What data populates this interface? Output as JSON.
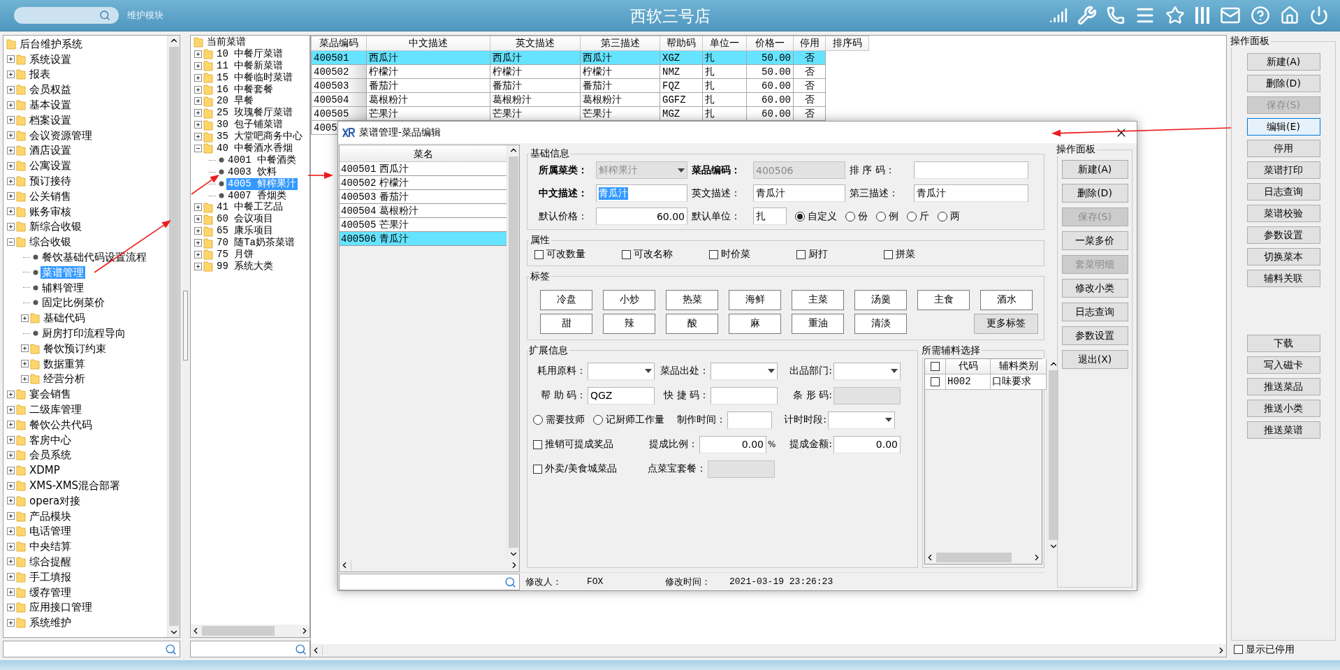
{
  "top_bar": {
    "module_label": "维护模块",
    "title": "西软三号店"
  },
  "system_tree": {
    "items": [
      {
        "label": "后台维护系统",
        "kind": "folder",
        "selected": false,
        "children": [
          {
            "label": "系统设置",
            "kind": "folder",
            "expanded": false,
            "selected": false
          },
          {
            "label": "报表",
            "kind": "folder",
            "expanded": false,
            "selected": false
          },
          {
            "label": "会员权益",
            "kind": "folder",
            "expanded": false,
            "selected": false
          },
          {
            "label": "基本设置",
            "kind": "folder",
            "expanded": false,
            "selected": false
          },
          {
            "label": "档案设置",
            "kind": "folder",
            "expanded": false,
            "selected": false
          },
          {
            "label": "会议资源管理",
            "kind": "folder",
            "expanded": false,
            "selected": false
          },
          {
            "label": "酒店设置",
            "kind": "folder",
            "expanded": false,
            "selected": false
          },
          {
            "label": "公寓设置",
            "kind": "folder",
            "expanded": false,
            "selected": false
          },
          {
            "label": "预订接待",
            "kind": "folder",
            "expanded": false,
            "selected": false
          },
          {
            "label": "公关销售",
            "kind": "folder",
            "expanded": false,
            "selected": false
          },
          {
            "label": "账务审核",
            "kind": "folder",
            "expanded": false,
            "selected": false
          },
          {
            "label": "新综合收银",
            "kind": "folder",
            "expanded": false,
            "selected": false
          },
          {
            "label": "综合收银",
            "kind": "folder",
            "expanded": true,
            "selected": false,
            "children": [
              {
                "label": "餐饮基础代码设置流程",
                "kind": "leaf",
                "selected": false
              },
              {
                "label": "菜谱管理",
                "kind": "leaf",
                "selected": true
              },
              {
                "label": "辅料管理",
                "kind": "leaf",
                "selected": false
              },
              {
                "label": "固定比例菜价",
                "kind": "leaf",
                "selected": false
              },
              {
                "label": "基础代码",
                "kind": "folder",
                "expanded": false,
                "selected": false
              },
              {
                "label": "厨房打印流程导向",
                "kind": "leaf",
                "selected": false
              },
              {
                "label": "餐饮预订约束",
                "kind": "folder",
                "expanded": false,
                "selected": false
              },
              {
                "label": "数据重算",
                "kind": "folder",
                "expanded": false,
                "selected": false
              },
              {
                "label": "经营分析",
                "kind": "folder",
                "expanded": false,
                "selected": false
              }
            ]
          },
          {
            "label": "宴会销售",
            "kind": "folder",
            "expanded": false,
            "selected": false
          },
          {
            "label": "二级库管理",
            "kind": "folder",
            "expanded": false,
            "selected": false
          },
          {
            "label": "餐饮公共代码",
            "kind": "folder",
            "expanded": false,
            "selected": false
          },
          {
            "label": "客房中心",
            "kind": "folder",
            "expanded": false,
            "selected": false
          },
          {
            "label": "会员系统",
            "kind": "folder",
            "expanded": false,
            "selected": false
          },
          {
            "label": "XDMP",
            "kind": "folder",
            "expanded": false,
            "selected": false
          },
          {
            "label": "XMS-XMS混合部署",
            "kind": "folder",
            "expanded": false,
            "selected": false
          },
          {
            "label": "opera对接",
            "kind": "folder",
            "expanded": false,
            "selected": false
          },
          {
            "label": "产品模块",
            "kind": "folder",
            "expanded": false,
            "selected": false
          },
          {
            "label": "电话管理",
            "kind": "folder",
            "expanded": false,
            "selected": false
          },
          {
            "label": "中央结算",
            "kind": "folder",
            "expanded": false,
            "selected": false
          },
          {
            "label": "综合提醒",
            "kind": "folder",
            "expanded": false,
            "selected": false
          },
          {
            "label": "手工填报",
            "kind": "folder",
            "expanded": false,
            "selected": false
          },
          {
            "label": "缓存管理",
            "kind": "folder",
            "expanded": false,
            "selected": false
          },
          {
            "label": "应用接口管理",
            "kind": "folder",
            "expanded": false,
            "selected": false
          },
          {
            "label": "系统维护",
            "kind": "folder",
            "expanded": false,
            "selected": false
          }
        ]
      }
    ]
  },
  "menu_tree": {
    "items": [
      {
        "label": "当前菜谱",
        "kind": "folder",
        "selected": false,
        "children": [
          {
            "label": "10 中餐厅菜谱",
            "kind": "folder",
            "expanded": false,
            "selected": false
          },
          {
            "label": "11 中餐新菜谱",
            "kind": "folder",
            "expanded": false,
            "selected": false
          },
          {
            "label": "15 中餐临时菜谱",
            "kind": "folder",
            "expanded": false,
            "selected": false
          },
          {
            "label": "16 中餐套餐",
            "kind": "folder",
            "expanded": false,
            "selected": false
          },
          {
            "label": "20 早餐",
            "kind": "folder",
            "expanded": false,
            "selected": false
          },
          {
            "label": "25 玫瑰餐厅菜谱",
            "kind": "folder",
            "expanded": false,
            "selected": false
          },
          {
            "label": "30 包子铺菜谱",
            "kind": "folder",
            "expanded": false,
            "selected": false
          },
          {
            "label": "35 大堂吧商务中心",
            "kind": "folder",
            "expanded": false,
            "selected": false
          },
          {
            "label": "40 中餐酒水香烟",
            "kind": "folder",
            "expanded": true,
            "selected": false,
            "children": [
              {
                "label": "4001 中餐酒类",
                "kind": "leaf",
                "selected": false
              },
              {
                "label": "4003 饮料",
                "kind": "leaf",
                "selected": false
              },
              {
                "label": "4005 鲜榨果汁",
                "kind": "leaf",
                "selected": true
              },
              {
                "label": "4007 香烟类",
                "kind": "leaf",
                "selected": false
              }
            ]
          },
          {
            "label": "41 中餐工艺品",
            "kind": "folder",
            "expanded": false,
            "selected": false
          },
          {
            "label": "60 会议项目",
            "kind": "folder",
            "expanded": false,
            "selected": false
          },
          {
            "label": "65 康乐项目",
            "kind": "folder",
            "expanded": false,
            "selected": false
          },
          {
            "label": "70 随Ta奶茶菜谱",
            "kind": "folder",
            "expanded": false,
            "selected": false
          },
          {
            "label": "75 月饼",
            "kind": "folder",
            "expanded": false,
            "selected": false
          },
          {
            "label": "99 系统大类",
            "kind": "folder",
            "expanded": false,
            "selected": false
          }
        ]
      }
    ]
  },
  "dish_table": {
    "columns": [
      "菜品编码",
      "中文描述",
      "英文描述",
      "第三描述",
      "帮助码",
      "单位一",
      "价格一",
      "停用",
      "排序码"
    ],
    "rows": [
      {
        "selected": true,
        "cells": [
          "400501",
          "西瓜汁",
          "西瓜汁",
          "西瓜汁",
          "XGZ",
          "扎",
          "50.00",
          "否"
        ]
      },
      {
        "selected": false,
        "cells": [
          "400502",
          "柠檬汁",
          "柠檬汁",
          "柠檬汁",
          "NMZ",
          "扎",
          "50.00",
          "否"
        ]
      },
      {
        "selected": false,
        "cells": [
          "400503",
          "番茄汁",
          "番茄汁",
          "番茄汁",
          "FQZ",
          "扎",
          "60.00",
          "否"
        ]
      },
      {
        "selected": false,
        "cells": [
          "400504",
          "葛根粉汁",
          "葛根粉汁",
          "葛根粉汁",
          "GGFZ",
          "扎",
          "60.00",
          "否"
        ]
      },
      {
        "selected": false,
        "cells": [
          "400505",
          "芒果汁",
          "芒果汁",
          "芒果汁",
          "MGZ",
          "扎",
          "60.00",
          "否"
        ]
      },
      {
        "selected": false,
        "cells": [
          "4005"
        ]
      }
    ]
  },
  "edit_dialog": {
    "title": "菜谱管理-菜品编辑",
    "dish_list": {
      "header": "菜名",
      "items": [
        {
          "code": "400501",
          "name": "西瓜汁",
          "selected": false
        },
        {
          "code": "400502",
          "name": "柠檬汁",
          "selected": false
        },
        {
          "code": "400503",
          "name": "番茄汁",
          "selected": false
        },
        {
          "code": "400504",
          "name": "葛根粉汁",
          "selected": false
        },
        {
          "code": "400505",
          "name": "芒果汁",
          "selected": false
        },
        {
          "code": "400506",
          "name": "青瓜汁",
          "selected": true
        }
      ]
    },
    "basic_info": {
      "title": "基础信息",
      "rows": [
        [
          {
            "label": "所属菜类：",
            "kind": "select",
            "value": "鲜榨果汁",
            "disabled": true,
            "emphasized": true,
            "highlighted": false
          },
          {
            "label": "菜品编码：",
            "kind": "text",
            "value": "400506",
            "disabled": true,
            "emphasized": true,
            "highlighted": false
          },
          {
            "label": "排 序 码：",
            "kind": "text",
            "disabled": false,
            "emphasized": false
          }
        ],
        [
          {
            "label": "中文描述：",
            "kind": "text",
            "value": "青瓜汁",
            "disabled": false,
            "emphasized": true,
            "highlighted": true
          },
          {
            "label": "英文描述：",
            "kind": "text",
            "value": "青瓜汁",
            "disabled": false,
            "emphasized": false,
            "highlighted": false
          },
          {
            "label": "第三描述：",
            "kind": "text",
            "value": "青瓜汁",
            "disabled": false,
            "emphasized": false,
            "highlighted": false
          }
        ],
        [
          {
            "label": "默认价格：",
            "kind": "number",
            "value": "60.00",
            "disabled": false,
            "emphasized": false,
            "highlighted": false
          },
          {
            "label": "默认单位：",
            "kind": "unit",
            "value": "扎",
            "disabled": false,
            "emphasized": false,
            "highlighted": false
          }
        ]
      ],
      "unit_options": [
        {
          "label": "自定义",
          "selected": true
        },
        {
          "label": "份",
          "selected": false
        },
        {
          "label": "例",
          "selected": false
        },
        {
          "label": "斤",
          "selected": false
        },
        {
          "label": "两",
          "selected": false
        }
      ]
    },
    "attributes": {
      "title": "属性",
      "items": [
        {
          "label": "可改数量",
          "checked": false
        },
        {
          "label": "可改名称",
          "checked": false
        },
        {
          "label": "时价菜",
          "checked": false
        },
        {
          "label": "厨打",
          "checked": false
        },
        {
          "label": "拼菜",
          "checked": false
        }
      ]
    },
    "tags": {
      "title": "标签",
      "items": [
        "冷盘",
        "小炒",
        "热菜",
        "海鲜",
        "主菜",
        "汤羹",
        "主食",
        "酒水",
        "甜",
        "辣",
        "酸",
        "麻",
        "重油",
        "清淡"
      ],
      "more_button": "更多标签"
    },
    "extended_info": {
      "title": "扩展信息",
      "rows": [
        {
          "items": [
            {
              "kind": "select",
              "label": "耗用原料：",
              "disabled": false
            },
            {
              "kind": "select",
              "label": "菜品出处：",
              "disabled": false
            },
            {
              "kind": "select",
              "label": "出品部门:",
              "disabled": false
            }
          ]
        },
        {
          "items": [
            {
              "kind": "text",
              "label": "帮 助 码：",
              "value": "QGZ",
              "disabled": false
            },
            {
              "kind": "text",
              "label": "快 捷 码：",
              "disabled": false
            },
            {
              "kind": "text",
              "label": "条 形 码:",
              "disabled": true
            }
          ]
        },
        {
          "items": [
            {
              "kind": "radio",
              "label": "需要技师",
              "selected": false
            },
            {
              "kind": "radio",
              "label": "记厨师工作量",
              "selected": false
            },
            {
              "kind": "short_text",
              "label": "制作时间：",
              "disabled": false
            },
            {
              "kind": "select",
              "label": "计时时段:",
              "disabled": false
            }
          ]
        },
        {
          "items": [
            {
              "kind": "checkbox",
              "label": "推销可提成奖品",
              "checked": false
            },
            {
              "kind": "number",
              "label": "提成比例：",
              "value": "0.00",
              "suffix": "%",
              "disabled": false
            },
            {
              "kind": "number",
              "label": "提成金额:",
              "value": "0.00",
              "disabled": false
            }
          ]
        },
        {
          "items": [
            {
              "kind": "checkbox",
              "label": "外卖/美食城菜品",
              "checked": false
            },
            {
              "kind": "text",
              "label": "点菜宝套餐：",
              "disabled": true
            }
          ]
        }
      ]
    },
    "accessory_selection": {
      "title": "所需辅料选择",
      "header_checked": false,
      "columns": [
        "代码",
        "辅料类别"
      ],
      "rows": [
        {
          "checked": false,
          "cells": [
            "H002",
            "口味要求"
          ]
        }
      ]
    },
    "footer": {
      "modifier_label": "修改人：",
      "modifier": "FOX",
      "modified_label": "修改时间：",
      "modified_at": "2021-03-19 23:26:23"
    },
    "side_panel": {
      "title": "操作面板",
      "buttons": [
        {
          "label": "新建(A)",
          "disabled": false
        },
        {
          "label": "删除(D)",
          "disabled": false
        },
        {
          "label": "保存(S)",
          "disabled": true
        },
        {
          "label": "一菜多价",
          "disabled": false
        },
        {
          "label": "套菜明细",
          "disabled": true
        },
        {
          "label": "修改小类",
          "disabled": false
        },
        {
          "label": "日志查询",
          "disabled": false
        },
        {
          "label": "参数设置",
          "disabled": false
        },
        {
          "label": "退出(X)",
          "disabled": false
        }
      ]
    }
  },
  "operation_panel": {
    "title": "操作面板",
    "primary_buttons": [
      {
        "label": "新建(A)",
        "disabled": false,
        "focused": false
      },
      {
        "label": "删除(D)",
        "disabled": false,
        "focused": false
      },
      {
        "label": "保存(S)",
        "disabled": true,
        "focused": false
      },
      {
        "label": "编辑(E)",
        "disabled": false,
        "focused": true
      },
      {
        "label": "停用",
        "disabled": false,
        "focused": false
      },
      {
        "label": "菜谱打印",
        "disabled": false,
        "focused": false
      },
      {
        "label": "日志查询",
        "disabled": false,
        "focused": false
      },
      {
        "label": "菜谱校验",
        "disabled": false,
        "focused": false
      },
      {
        "label": "参数设置",
        "disabled": false,
        "focused": false
      },
      {
        "label": "切换菜本",
        "disabled": false,
        "focused": false
      },
      {
        "label": "辅料关联",
        "disabled": false,
        "focused": false
      }
    ],
    "secondary_buttons": [
      {
        "label": "下载",
        "disabled": false,
        "focused": false
      },
      {
        "label": "写入磁卡",
        "disabled": false,
        "focused": false
      },
      {
        "label": "推送菜品",
        "disabled": false,
        "focused": false
      },
      {
        "label": "推送小类",
        "disabled": false,
        "focused": false
      },
      {
        "label": "推送菜谱",
        "disabled": false,
        "focused": false
      }
    ],
    "show_disabled": {
      "label": "显示已停用",
      "checked": false
    }
  }
}
